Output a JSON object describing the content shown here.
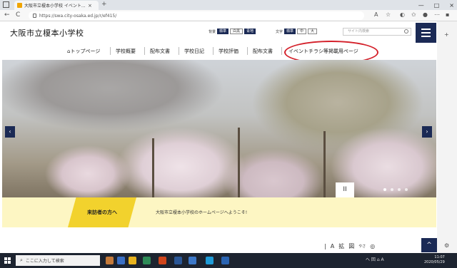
{
  "browser": {
    "tab_title": "大阪市立榎本小学校 イベント...",
    "tab_close": "×",
    "new_tab": "+",
    "url": "https://swa.city-osaka.ed.jp/r/ef415/",
    "back": "←",
    "reload": "C",
    "win_minimize": "—",
    "win_maximize": "□",
    "win_close": "×"
  },
  "site": {
    "title": "大阪市立榎本小学校",
    "display_label": "背景",
    "display_options": [
      "標準",
      "白黒",
      "青地"
    ],
    "font_label": "文字",
    "font_options": [
      "標準",
      "中",
      "大"
    ],
    "search_placeholder": "サイト内検索"
  },
  "nav": {
    "items": [
      "トップページ",
      "学校概要",
      "配布文書",
      "学校日記",
      "学校評価",
      "配布文書",
      "イベントチラシ等掲載用ページ"
    ]
  },
  "hero": {
    "prev": "‹",
    "next": "›",
    "pause": "II",
    "dots": 4,
    "active_dot": 0
  },
  "visitor": {
    "tab_label": "来訪者の方へ",
    "message": "大阪市立榎本小学校のホームページへようこそ!"
  },
  "tools": {
    "items": [
      "A",
      "拡",
      "図",
      "やさ",
      "◎"
    ],
    "pagetop": "^"
  },
  "taskbar": {
    "search_placeholder": "ここに入力して検索",
    "tray": "へ 回 ⌂ A",
    "time": "11:07",
    "date": "2020/05/29"
  },
  "colors": {
    "brand_navy": "#1b2a55",
    "accent_yellow": "#f2d22d",
    "banner_bg": "#fdf6c3",
    "highlight_red": "#d4202a"
  }
}
